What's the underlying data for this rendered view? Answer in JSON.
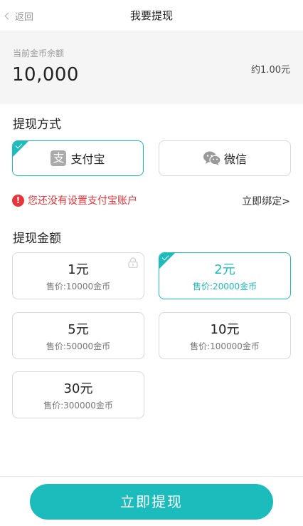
{
  "nav": {
    "back_label": "返回",
    "title": "我要提现"
  },
  "balance": {
    "label": "当前金币余额",
    "amount": "10,000",
    "approx": "约1.00元"
  },
  "method": {
    "title": "提现方式",
    "options": [
      {
        "label": "支付宝",
        "icon": "alipay-icon",
        "selected": true
      },
      {
        "label": "微信",
        "icon": "wechat-icon",
        "selected": false
      }
    ],
    "warning": "您还没有设置支付宝账户",
    "bind_link": "立即绑定>"
  },
  "amounts": {
    "title": "提现金额",
    "items": [
      {
        "value": "1元",
        "price": "售价:10000金币",
        "locked": true,
        "selected": false
      },
      {
        "value": "2元",
        "price": "售价:20000金币",
        "locked": false,
        "selected": true
      },
      {
        "value": "5元",
        "price": "售价:50000金币",
        "locked": false,
        "selected": false
      },
      {
        "value": "10元",
        "price": "售价:100000金币",
        "locked": false,
        "selected": false
      },
      {
        "value": "30元",
        "price": "售价:300000金币",
        "locked": false,
        "selected": false
      }
    ]
  },
  "submit_label": "立即提现",
  "colors": {
    "accent": "#1cbcbc",
    "warning": "#e8343a",
    "background": "#f5f5f5"
  }
}
